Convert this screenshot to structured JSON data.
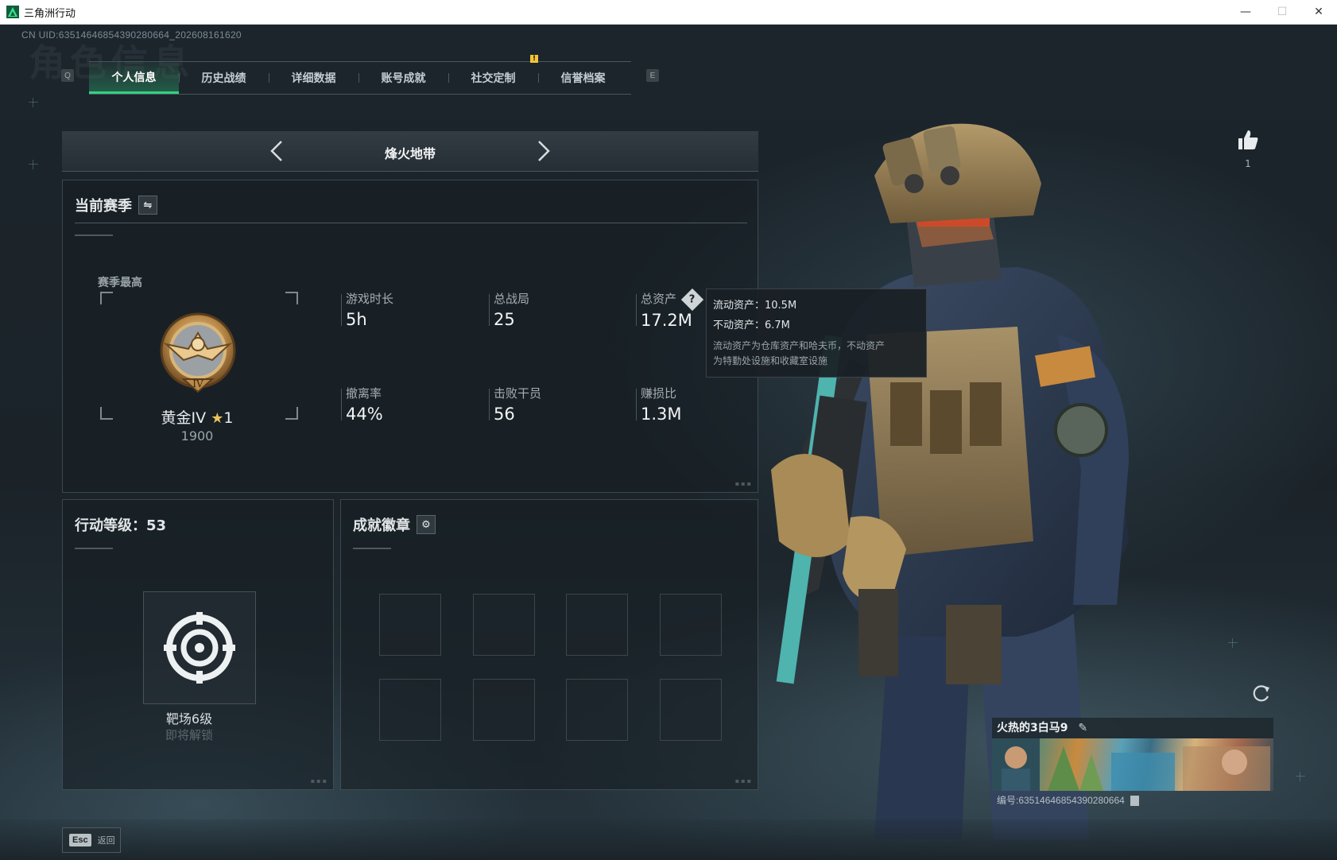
{
  "window": {
    "title": "三角洲行动",
    "minimize": "—",
    "maximize": "☐",
    "close": "✕"
  },
  "header": {
    "uid": "CN UID:63514646854390280664_202608161620",
    "watermark": "角色信息",
    "prev_key": "Q",
    "next_key": "E"
  },
  "tabs": [
    {
      "label": "个人信息",
      "active": true
    },
    {
      "label": "历史战绩",
      "active": false
    },
    {
      "label": "详细数据",
      "active": false
    },
    {
      "label": "账号成就",
      "active": false
    },
    {
      "label": "社交定制",
      "active": false,
      "notice": "!"
    },
    {
      "label": "信誉档案",
      "active": false
    }
  ],
  "mode": {
    "title": "烽火地带"
  },
  "season": {
    "title": "当前赛季",
    "switch_icon": "swap-icon",
    "best_label": "赛季最高",
    "rank_name": "黄金IV",
    "rank_star": "★",
    "rank_stars": "1",
    "rank_score": "1900",
    "rank_numeral": "IV",
    "stats": [
      {
        "label": "游戏时长",
        "value": "5h"
      },
      {
        "label": "总战局",
        "value": "25"
      },
      {
        "label": "总资产",
        "value": "17.2M",
        "help": "?"
      },
      {
        "label": "撤离率",
        "value": "44%"
      },
      {
        "label": "击败干员",
        "value": "56"
      },
      {
        "label": "赚损比",
        "value": "1.3M"
      }
    ]
  },
  "tooltip": {
    "liquid": "流动资产：10.5M",
    "fixed": "不动资产：6.7M",
    "desc_line1": "流动资产为仓库资产和哈夫币，不动资产",
    "desc_line2": "为特勤处设施和收藏室设施"
  },
  "level": {
    "title": "行动等级：53",
    "target_label": "靶场6级",
    "target_sub": "即将解锁"
  },
  "badges": {
    "title": "成就徽章",
    "settings_icon": "⚙",
    "slot_count": 8
  },
  "profile": {
    "likes": "1",
    "name": "火热的3白马9",
    "edit_icon": "✎",
    "id_line": "编号:63514646854390280664"
  },
  "footer": {
    "esc_key": "Esc",
    "esc_label": "返回"
  },
  "colors": {
    "accent": "#35d07f",
    "notice": "#f0c53a",
    "gold_star": "#e8c35a"
  }
}
